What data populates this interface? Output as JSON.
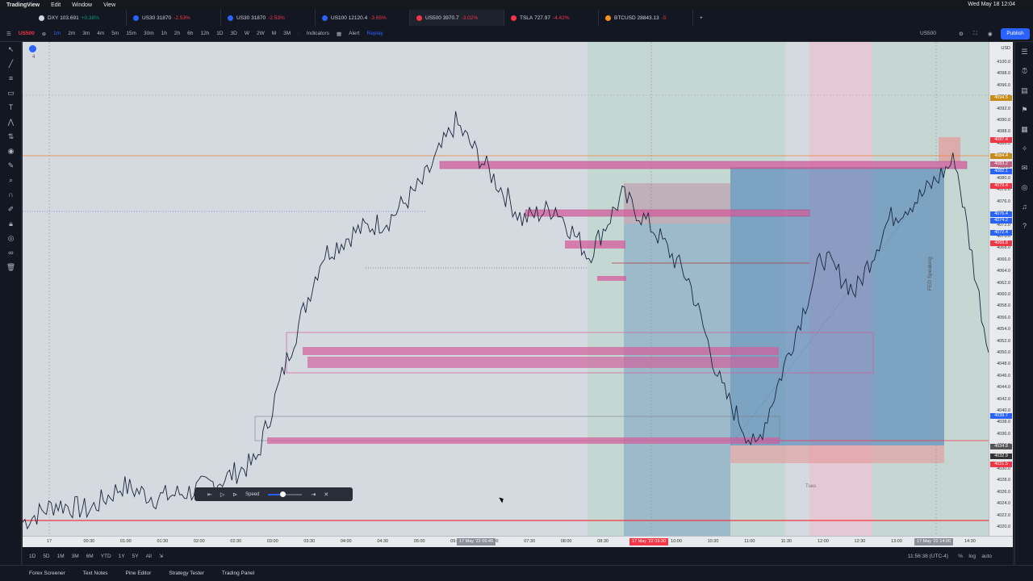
{
  "mac_menu": {
    "app_name": "TradingView",
    "items": [
      "Edit",
      "Window",
      "View"
    ],
    "clock": "Wed May 18 12:04"
  },
  "tabs": [
    {
      "symbol": "DXY",
      "price": "103.691",
      "change": "+0.38%",
      "direction": "up",
      "color": "#d1d4dc"
    },
    {
      "symbol": "US30",
      "price": "31870",
      "change": "-2.53%",
      "direction": "down",
      "color": "#2962ff"
    },
    {
      "symbol": "US30",
      "price": "31870",
      "change": "-2.53%",
      "direction": "down",
      "color": "#2962ff"
    },
    {
      "symbol": "US100",
      "price": "12120.4",
      "change": "-3.65%",
      "direction": "down",
      "color": "#2962ff"
    },
    {
      "symbol": "US500",
      "price": "3970.7",
      "change": "-3.02%",
      "direction": "down",
      "color": "#f23645"
    },
    {
      "symbol": "TSLA",
      "price": "727.97",
      "change": "-4.42%",
      "direction": "down",
      "color": "#f23645"
    },
    {
      "symbol": "BTCUSD",
      "price": "28843.13",
      "change": "-5",
      "direction": "down",
      "color": "#f7931a"
    }
  ],
  "toolbar": {
    "symbol": "US500",
    "intervals": [
      "1m",
      "2m",
      "3m",
      "4m",
      "5m",
      "15m",
      "30m",
      "1h",
      "2h",
      "6h",
      "12h",
      "1D",
      "3D",
      "W",
      "2W",
      "M",
      "3M"
    ],
    "indicators_label": "Indicators",
    "alert_label": "Alert",
    "replay_label": "Replay",
    "right_symbol": "US500",
    "publish_label": "Publish"
  },
  "price_axis": {
    "currency": "USD",
    "labels": [
      "4100.0",
      "4098.0",
      "4096.0",
      "4094.0",
      "4092.0",
      "4090.0",
      "4088.0",
      "4086.0",
      "4084.0",
      "4082.0",
      "4080.0",
      "4078.0",
      "4076.0",
      "4074.0",
      "4072.0",
      "4070.0",
      "4068.0",
      "4066.0",
      "4064.0",
      "4062.0",
      "4060.0",
      "4058.0",
      "4056.0",
      "4054.0",
      "4052.0",
      "4050.0",
      "4048.0",
      "4046.0",
      "4044.0",
      "4042.0",
      "4040.0",
      "4038.0",
      "4036.0",
      "4034.0",
      "4032.0",
      "4030.0",
      "4028.0",
      "4026.0",
      "4024.0",
      "4022.0",
      "4020.0"
    ],
    "badges": [
      {
        "text": "US500",
        "value": "4094.5",
        "color": "#c88a1a"
      },
      {
        "text": "4087.4",
        "color": "#f23645"
      },
      {
        "text": "4084.4",
        "color": "#c88a1a"
      },
      {
        "text": "4083.2",
        "color": "#c06080"
      },
      {
        "text": "4082.1",
        "color": "#2962ff"
      },
      {
        "text": "4079.4",
        "color": "#f23645"
      },
      {
        "text": "4076.4",
        "color": "#2962ff"
      },
      {
        "text": "4074.2",
        "color": "#2962ff"
      },
      {
        "text": "4072.4",
        "color": "#2962ff"
      },
      {
        "text": "4069.8",
        "color": "#f23645"
      },
      {
        "text": "4039.7",
        "color": "#2962ff"
      },
      {
        "text": "4034.8",
        "color": "#555555"
      },
      {
        "text": "4032.9",
        "color": "#333333"
      },
      {
        "text": "4031.5",
        "color": "#f23645"
      }
    ]
  },
  "time_axis": {
    "labels": [
      "17",
      "00:30",
      "01:00",
      "01:30",
      "02:00",
      "02:30",
      "03:00",
      "03:30",
      "04:00",
      "04:30",
      "05:00",
      "05:30",
      "06:00",
      "07:30",
      "08:00",
      "08:30",
      "09:00",
      "10:00",
      "10:30",
      "11:00",
      "11:30",
      "12:00",
      "12:30",
      "13:00",
      "13:30",
      "14:30"
    ],
    "badges": [
      "17 May '22  06:46",
      "17 May '22  09:30",
      "17 May '22  14:00"
    ]
  },
  "chart_data": {
    "type": "line",
    "symbol": "US500",
    "x": [
      "00:00",
      "00:30",
      "01:00",
      "01:30",
      "02:00",
      "02:30",
      "03:00",
      "03:30",
      "04:00",
      "04:30",
      "05:00",
      "05:30",
      "06:00",
      "06:30",
      "07:00",
      "07:30",
      "08:00",
      "08:30",
      "09:00",
      "09:30",
      "10:00",
      "10:30",
      "11:00",
      "11:30",
      "12:00",
      "12:30",
      "13:00",
      "13:30",
      "14:00",
      "14:30"
    ],
    "series": [
      {
        "values": [
          4022,
          4025,
          4024,
          4028,
          4026,
          4027,
          4029,
          4032,
          4050,
          4066,
          4070,
          4072,
          4078,
          4088,
          4080,
          4072,
          4074,
          4066,
          4076,
          4070,
          4062,
          4044,
          4034,
          4050,
          4066,
          4060,
          4072,
          4076,
          4082,
          4050
        ]
      }
    ],
    "ylim": [
      4020,
      4100
    ],
    "annotations": [
      "FED Speaking",
      "Tues"
    ]
  },
  "annotations": {
    "fed_label": "FED Speaking",
    "day_label": "Tues",
    "legend_number": "4"
  },
  "replay_bar": {
    "speed_label": "Speed",
    "speed": 0.45
  },
  "range_bar": {
    "ranges": [
      "1D",
      "5D",
      "1M",
      "3M",
      "6M",
      "YTD",
      "1Y",
      "5Y",
      "All"
    ],
    "clock": "11:56:38 (UTC-4)",
    "percent_label": "%",
    "log_label": "log",
    "auto_label": "auto"
  },
  "bottom_panel": {
    "items": [
      "Forex Screener",
      "Text Notes",
      "Pine Editor",
      "Strategy Tester",
      "Trading Panel"
    ]
  }
}
